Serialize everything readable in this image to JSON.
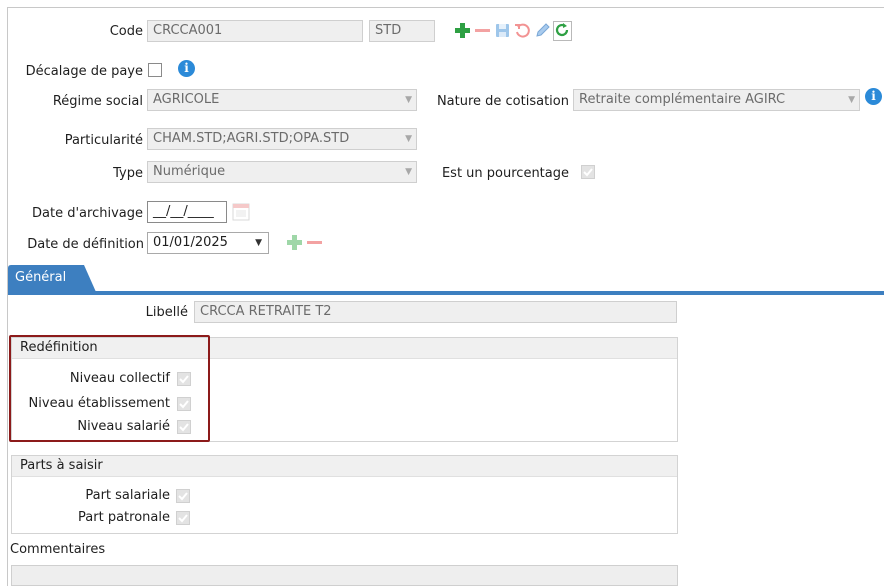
{
  "form": {
    "code_label": "Code",
    "code_value": "CRCCA001",
    "std_value": "STD",
    "decalage_label": "Décalage de paye",
    "regime_label": "Régime social",
    "regime_value": "AGRICOLE",
    "nature_label": "Nature de cotisation",
    "nature_value": "Retraite complémentaire AGIRC",
    "particularite_label": "Particularité",
    "particularite_value": "CHAM.STD;AGRI.STD;OPA.STD",
    "type_label": "Type",
    "type_value": "Numérique",
    "pourcentage_label": "Est un pourcentage",
    "pourcentage_checked": true,
    "archivage_label": "Date d'archivage",
    "archivage_value": "__/__/____",
    "definition_label": "Date de définition",
    "definition_value": "01/01/2025",
    "decalage_checked": false
  },
  "toolbar": {
    "add": "plus-icon",
    "remove": "minus-icon",
    "save": "save-icon",
    "undo": "undo-icon",
    "edit": "pencil-icon",
    "refresh": "refresh-icon"
  },
  "tabs": [
    {
      "label": "Général",
      "active": true
    }
  ],
  "general": {
    "libelle_label": "Libellé",
    "libelle_value": "CRCCA RETRAITE  T2",
    "redefinition": {
      "title": "Redéfinition",
      "items": [
        {
          "label": "Niveau collectif",
          "checked": true
        },
        {
          "label": "Niveau établissement",
          "checked": true
        },
        {
          "label": "Niveau salarié",
          "checked": true
        }
      ]
    },
    "parts": {
      "title": "Parts à saisir",
      "items": [
        {
          "label": "Part salariale",
          "checked": true
        },
        {
          "label": "Part patronale",
          "checked": true
        }
      ]
    },
    "commentaires_label": "Commentaires"
  },
  "colors": {
    "tab_blue": "#3d7fc0",
    "green": "#2ea043",
    "red_highlight": "#8c1a1a",
    "info_blue": "#2b8ad8"
  }
}
